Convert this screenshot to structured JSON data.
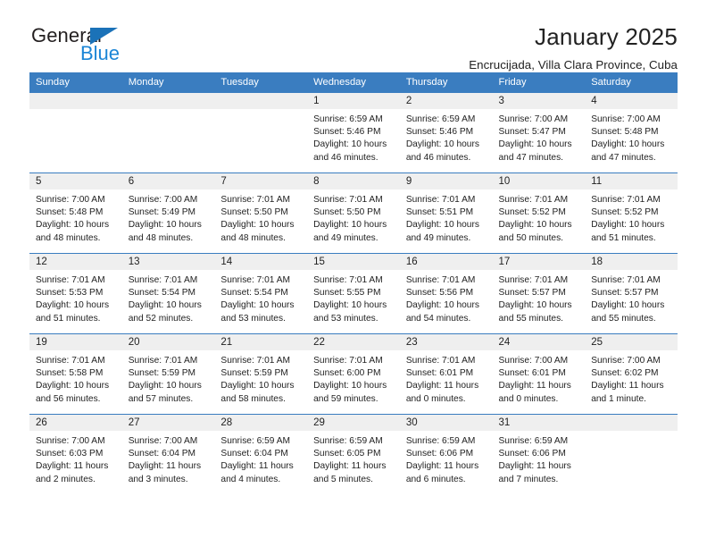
{
  "brand": {
    "name_part1": "General",
    "name_part2": "Blue",
    "triangle_color": "#1b72b8",
    "blue_text_color": "#1b85d6"
  },
  "header": {
    "title": "January 2025",
    "subtitle": "Encrucijada, Villa Clara Province, Cuba"
  },
  "theme": {
    "header_row_color": "#3a7dc0",
    "day_band_color": "#efefef",
    "text_color": "#1f1f1f"
  },
  "weekday_headers": [
    "Sunday",
    "Monday",
    "Tuesday",
    "Wednesday",
    "Thursday",
    "Friday",
    "Saturday"
  ],
  "weeks": [
    [
      {
        "day": "",
        "detail": ""
      },
      {
        "day": "",
        "detail": ""
      },
      {
        "day": "",
        "detail": ""
      },
      {
        "day": "1",
        "detail": "Sunrise: 6:59 AM\nSunset: 5:46 PM\nDaylight: 10 hours and 46 minutes."
      },
      {
        "day": "2",
        "detail": "Sunrise: 6:59 AM\nSunset: 5:46 PM\nDaylight: 10 hours and 46 minutes."
      },
      {
        "day": "3",
        "detail": "Sunrise: 7:00 AM\nSunset: 5:47 PM\nDaylight: 10 hours and 47 minutes."
      },
      {
        "day": "4",
        "detail": "Sunrise: 7:00 AM\nSunset: 5:48 PM\nDaylight: 10 hours and 47 minutes."
      }
    ],
    [
      {
        "day": "5",
        "detail": "Sunrise: 7:00 AM\nSunset: 5:48 PM\nDaylight: 10 hours and 48 minutes."
      },
      {
        "day": "6",
        "detail": "Sunrise: 7:00 AM\nSunset: 5:49 PM\nDaylight: 10 hours and 48 minutes."
      },
      {
        "day": "7",
        "detail": "Sunrise: 7:01 AM\nSunset: 5:50 PM\nDaylight: 10 hours and 48 minutes."
      },
      {
        "day": "8",
        "detail": "Sunrise: 7:01 AM\nSunset: 5:50 PM\nDaylight: 10 hours and 49 minutes."
      },
      {
        "day": "9",
        "detail": "Sunrise: 7:01 AM\nSunset: 5:51 PM\nDaylight: 10 hours and 49 minutes."
      },
      {
        "day": "10",
        "detail": "Sunrise: 7:01 AM\nSunset: 5:52 PM\nDaylight: 10 hours and 50 minutes."
      },
      {
        "day": "11",
        "detail": "Sunrise: 7:01 AM\nSunset: 5:52 PM\nDaylight: 10 hours and 51 minutes."
      }
    ],
    [
      {
        "day": "12",
        "detail": "Sunrise: 7:01 AM\nSunset: 5:53 PM\nDaylight: 10 hours and 51 minutes."
      },
      {
        "day": "13",
        "detail": "Sunrise: 7:01 AM\nSunset: 5:54 PM\nDaylight: 10 hours and 52 minutes."
      },
      {
        "day": "14",
        "detail": "Sunrise: 7:01 AM\nSunset: 5:54 PM\nDaylight: 10 hours and 53 minutes."
      },
      {
        "day": "15",
        "detail": "Sunrise: 7:01 AM\nSunset: 5:55 PM\nDaylight: 10 hours and 53 minutes."
      },
      {
        "day": "16",
        "detail": "Sunrise: 7:01 AM\nSunset: 5:56 PM\nDaylight: 10 hours and 54 minutes."
      },
      {
        "day": "17",
        "detail": "Sunrise: 7:01 AM\nSunset: 5:57 PM\nDaylight: 10 hours and 55 minutes."
      },
      {
        "day": "18",
        "detail": "Sunrise: 7:01 AM\nSunset: 5:57 PM\nDaylight: 10 hours and 55 minutes."
      }
    ],
    [
      {
        "day": "19",
        "detail": "Sunrise: 7:01 AM\nSunset: 5:58 PM\nDaylight: 10 hours and 56 minutes."
      },
      {
        "day": "20",
        "detail": "Sunrise: 7:01 AM\nSunset: 5:59 PM\nDaylight: 10 hours and 57 minutes."
      },
      {
        "day": "21",
        "detail": "Sunrise: 7:01 AM\nSunset: 5:59 PM\nDaylight: 10 hours and 58 minutes."
      },
      {
        "day": "22",
        "detail": "Sunrise: 7:01 AM\nSunset: 6:00 PM\nDaylight: 10 hours and 59 minutes."
      },
      {
        "day": "23",
        "detail": "Sunrise: 7:01 AM\nSunset: 6:01 PM\nDaylight: 11 hours and 0 minutes."
      },
      {
        "day": "24",
        "detail": "Sunrise: 7:00 AM\nSunset: 6:01 PM\nDaylight: 11 hours and 0 minutes."
      },
      {
        "day": "25",
        "detail": "Sunrise: 7:00 AM\nSunset: 6:02 PM\nDaylight: 11 hours and 1 minute."
      }
    ],
    [
      {
        "day": "26",
        "detail": "Sunrise: 7:00 AM\nSunset: 6:03 PM\nDaylight: 11 hours and 2 minutes."
      },
      {
        "day": "27",
        "detail": "Sunrise: 7:00 AM\nSunset: 6:04 PM\nDaylight: 11 hours and 3 minutes."
      },
      {
        "day": "28",
        "detail": "Sunrise: 6:59 AM\nSunset: 6:04 PM\nDaylight: 11 hours and 4 minutes."
      },
      {
        "day": "29",
        "detail": "Sunrise: 6:59 AM\nSunset: 6:05 PM\nDaylight: 11 hours and 5 minutes."
      },
      {
        "day": "30",
        "detail": "Sunrise: 6:59 AM\nSunset: 6:06 PM\nDaylight: 11 hours and 6 minutes."
      },
      {
        "day": "31",
        "detail": "Sunrise: 6:59 AM\nSunset: 6:06 PM\nDaylight: 11 hours and 7 minutes."
      },
      {
        "day": "",
        "detail": ""
      }
    ]
  ]
}
